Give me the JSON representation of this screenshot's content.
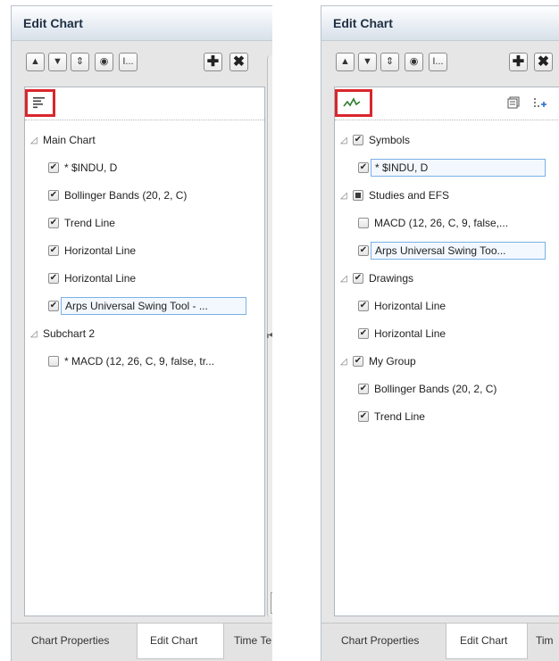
{
  "left": {
    "title": "Edit Chart",
    "toolbar": {
      "move_up": "▲",
      "move_down": "▼",
      "move_both": "⇕",
      "visibility": "◉",
      "rename": "I...",
      "add": "✚",
      "remove": "✖"
    },
    "view_mode_icon": "list-view-icon",
    "groups": [
      {
        "label": "Main Chart",
        "items": [
          {
            "label": "* $INDU, D",
            "checked": true
          },
          {
            "label": "Bollinger Bands (20, 2, C)",
            "checked": true
          },
          {
            "label": "Trend Line",
            "checked": true
          },
          {
            "label": "Horizontal Line",
            "checked": true
          },
          {
            "label": "Horizontal Line",
            "checked": true
          },
          {
            "label": "Arps Universal Swing Tool - ...",
            "checked": true,
            "selected": true
          }
        ]
      },
      {
        "label": "Subchart 2",
        "items": [
          {
            "label": "* MACD (12, 26, C, 9, false, tr...",
            "checked": false
          }
        ]
      }
    ],
    "tabs": [
      "Chart Properties",
      "Edit Chart",
      "Time Te"
    ]
  },
  "right": {
    "title": "Edit Chart",
    "toolbar": {
      "move_up": "▲",
      "move_down": "▼",
      "move_both": "⇕",
      "visibility": "◉",
      "rename": "I...",
      "add": "✚",
      "remove": "✖"
    },
    "view_mode_icon": "chart-line-icon",
    "group_icon": "copy-group-icon",
    "add_group_icon": "add-group-icon",
    "groups": [
      {
        "label": "Symbols",
        "state": "checked",
        "items": [
          {
            "label": "* $INDU, D",
            "checked": true,
            "selected": true
          }
        ]
      },
      {
        "label": "Studies and EFS",
        "state": "partial",
        "items": [
          {
            "label": "MACD (12, 26, C, 9, false,...",
            "checked": false
          },
          {
            "label": "Arps Universal Swing Too...",
            "checked": true,
            "selected": true
          }
        ]
      },
      {
        "label": "Drawings",
        "state": "checked",
        "items": [
          {
            "label": "Horizontal Line",
            "checked": true
          },
          {
            "label": "Horizontal Line",
            "checked": true
          }
        ]
      },
      {
        "label": "My Group",
        "state": "checked",
        "items": [
          {
            "label": "Bollinger Bands (20, 2, C)",
            "checked": true
          },
          {
            "label": "Trend Line",
            "checked": true
          }
        ]
      }
    ],
    "tabs": [
      "Chart Properties",
      "Edit Chart",
      "Tim"
    ]
  },
  "colors": {
    "highlight": "#d9262c",
    "selection_border": "#7ab0e6",
    "title_text": "#1f2f43"
  }
}
